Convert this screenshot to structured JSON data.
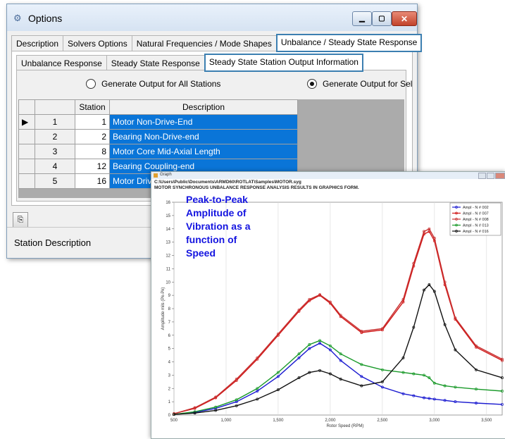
{
  "window": {
    "title": "Options",
    "tabs": [
      "Description",
      "Solvers Options",
      "Natural Frequencies / Mode Shapes",
      "Unbalance / Steady State Response"
    ],
    "subtabs": [
      "Unbalance Response",
      "Steady State Response",
      "Steady State Station Output Information"
    ],
    "radio_all": "Generate Output for All Stations",
    "radio_selected": "Generate Output for Sel",
    "grid": {
      "headers": [
        "",
        "",
        "Station",
        "Description"
      ],
      "rows": [
        {
          "marker": "▶",
          "index": "1",
          "station": "1",
          "description": "Motor Non-Drive-End"
        },
        {
          "marker": "",
          "index": "2",
          "station": "2",
          "description": "Bearing Non-Drive-end"
        },
        {
          "marker": "",
          "index": "3",
          "station": "8",
          "description": "Motor Core Mid-Axial Length"
        },
        {
          "marker": "",
          "index": "4",
          "station": "12",
          "description": "Bearing Coupling-end"
        },
        {
          "marker": "",
          "index": "5",
          "station": "16",
          "description": "Motor Drive-E"
        }
      ]
    },
    "status": "Station Description"
  },
  "graph": {
    "window_title": "Graph",
    "path": "C:\\Users\\Public\\Documents\\ARMD60\\ROTLAT\\Samples\\MOTOR.syg",
    "subtitle": "MOTOR SYNCHRONOUS UNBALANCE RESPONSE ANALYSIS RESULTS IN GRAPHICS FORM.",
    "annotation": "Peak-to-Peak\nAmplitude of\nVibration as a\nfunction of\nSpeed"
  },
  "chart_data": {
    "type": "line",
    "title": "",
    "xlabel": "Rotor Speed (RPM)",
    "ylabel": "Amplitude mils (Pk-Pk)",
    "xlim": [
      500,
      3650
    ],
    "ylim": [
      0,
      16
    ],
    "xticks": [
      500,
      1000,
      1500,
      2000,
      2500,
      3000,
      3500
    ],
    "xtick_labels": [
      "500",
      "1,000",
      "1,500",
      "2,000",
      "2,500",
      "3,000",
      "3,500"
    ],
    "yticks": [
      0,
      1,
      2,
      3,
      4,
      5,
      6,
      7,
      8,
      9,
      10,
      11,
      12,
      13,
      14,
      15,
      16
    ],
    "grid": true,
    "legend_position": "top-right",
    "x": [
      500,
      700,
      900,
      1100,
      1300,
      1500,
      1700,
      1800,
      1900,
      2000,
      2100,
      2300,
      2500,
      2700,
      2800,
      2900,
      2950,
      3000,
      3100,
      3200,
      3400,
      3650
    ],
    "series": [
      {
        "name": "Ampl - N # 002",
        "color": "#1a1ad0",
        "values": [
          0.05,
          0.2,
          0.5,
          1.0,
          1.8,
          2.9,
          4.3,
          5.0,
          5.4,
          4.9,
          4.1,
          2.9,
          2.1,
          1.6,
          1.45,
          1.3,
          1.25,
          1.2,
          1.1,
          1.0,
          0.9,
          0.8
        ]
      },
      {
        "name": "Ampl - N # 007",
        "color": "#d01818",
        "values": [
          0.1,
          0.5,
          1.3,
          2.6,
          4.2,
          6.0,
          7.8,
          8.6,
          9.0,
          8.4,
          7.4,
          6.2,
          6.4,
          8.5,
          11.2,
          13.6,
          13.8,
          13.1,
          9.8,
          7.2,
          5.1,
          4.1
        ]
      },
      {
        "name": "Ampl - N # 008",
        "color": "#c83030",
        "values": [
          0.1,
          0.55,
          1.35,
          2.7,
          4.3,
          6.1,
          7.9,
          8.7,
          9.05,
          8.5,
          7.5,
          6.3,
          6.5,
          8.7,
          11.4,
          13.8,
          14.0,
          13.3,
          10.0,
          7.3,
          5.2,
          4.2
        ]
      },
      {
        "name": "Ampl - N # 013",
        "color": "#1a9a2a",
        "values": [
          0.05,
          0.25,
          0.6,
          1.15,
          2.0,
          3.2,
          4.6,
          5.3,
          5.6,
          5.2,
          4.6,
          3.8,
          3.4,
          3.2,
          3.1,
          3.0,
          2.8,
          2.4,
          2.2,
          2.1,
          1.95,
          1.8
        ]
      },
      {
        "name": "Ampl - N # 016",
        "color": "#111111",
        "values": [
          0.05,
          0.15,
          0.35,
          0.7,
          1.2,
          1.9,
          2.8,
          3.2,
          3.35,
          3.1,
          2.7,
          2.2,
          2.5,
          4.3,
          6.6,
          9.4,
          9.8,
          9.3,
          6.8,
          4.9,
          3.4,
          2.8
        ]
      }
    ]
  }
}
